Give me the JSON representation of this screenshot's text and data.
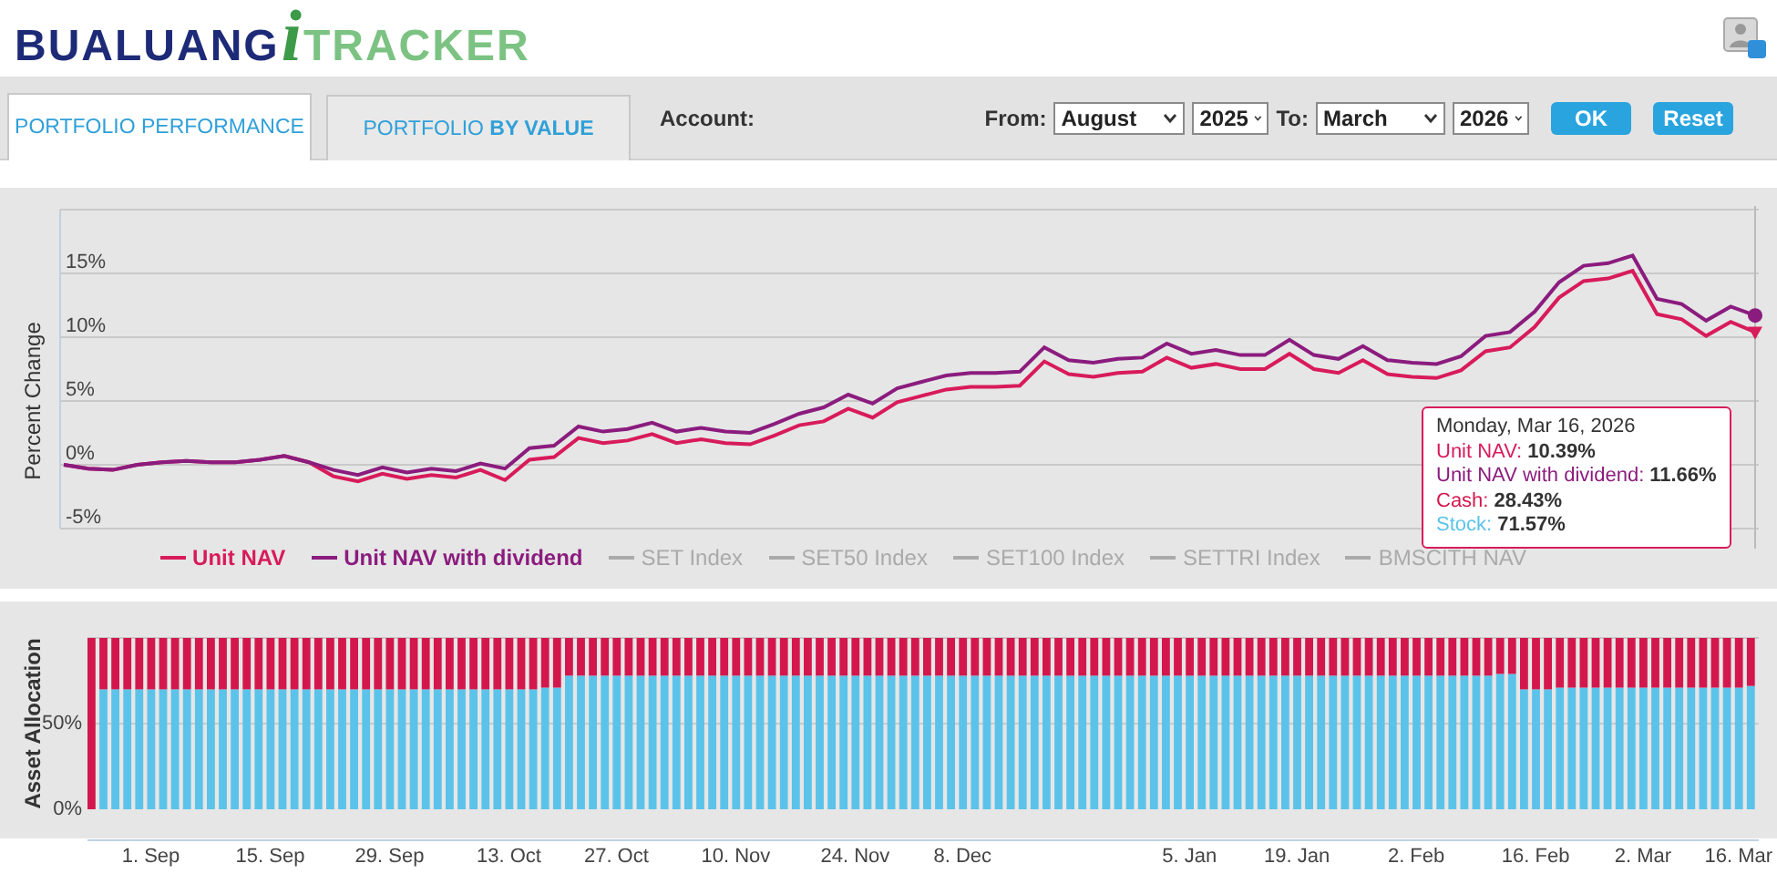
{
  "header": {
    "logo": {
      "brand": "BUALUANG",
      "mark": "i",
      "product": "TRACKER"
    }
  },
  "toolbar": {
    "tabs": [
      {
        "label": "PORTFOLIO PERFORMANCE",
        "selected": true
      },
      {
        "label": "PORTFOLIO **BY VALUE**",
        "selected": false
      }
    ],
    "account_label": "Account:",
    "from_label": "From:",
    "from_month": "August",
    "from_year": "2025",
    "to_label": "To:",
    "to_month": "March",
    "to_year": "2026",
    "buttons": [
      "OK",
      "Reset"
    ]
  },
  "performance": {
    "chart_data": {
      "type": "line",
      "grid": true,
      "ylabel": "Percent Change",
      "ylim": [
        -5,
        20
      ],
      "yticks": [
        {
          "value": -5,
          "label": "-5%"
        },
        {
          "value": 0,
          "label": "0%"
        },
        {
          "value": 5,
          "label": "5%"
        },
        {
          "value": 10,
          "label": "10%"
        },
        {
          "value": 15,
          "label": "15%"
        }
      ],
      "series": [
        {
          "name": "Unit NAV",
          "color": "#d81b5a",
          "values": [
            0,
            -0.3,
            -0.4,
            0,
            0.2,
            0.3,
            0.2,
            0.2,
            0.4,
            0.7,
            0.2,
            -0.9,
            -1.3,
            -0.7,
            -1.1,
            -0.8,
            -1,
            -0.4,
            -1.2,
            0.4,
            0.6,
            2.1,
            1.7,
            1.9,
            2.4,
            1.7,
            2,
            1.7,
            1.6,
            2.3,
            3.1,
            3.4,
            4.4,
            3.7,
            4.9,
            5.4,
            5.9,
            6.1,
            6.1,
            6.2,
            8.1,
            7.1,
            6.9,
            7.2,
            7.3,
            8.4,
            7.6,
            7.9,
            7.5,
            7.5,
            8.7,
            7.5,
            7.2,
            8.2,
            7.1,
            6.9,
            6.8,
            7.4,
            8.9,
            9.2,
            10.8,
            13.1,
            14.4,
            14.6,
            15.2,
            11.8,
            11.4,
            10.1,
            11.2,
            10.4
          ]
        },
        {
          "name": "Unit NAV with dividend",
          "color": "#8b1c7e",
          "values": [
            0,
            -0.3,
            -0.4,
            0,
            0.2,
            0.3,
            0.2,
            0.2,
            0.4,
            0.7,
            0.2,
            -0.4,
            -0.8,
            -0.2,
            -0.6,
            -0.3,
            -0.5,
            0.1,
            -0.3,
            1.3,
            1.5,
            3,
            2.6,
            2.8,
            3.3,
            2.6,
            2.9,
            2.6,
            2.5,
            3.2,
            4,
            4.5,
            5.5,
            4.8,
            6,
            6.5,
            7,
            7.2,
            7.2,
            7.3,
            9.2,
            8.2,
            8,
            8.3,
            8.4,
            9.5,
            8.7,
            9,
            8.6,
            8.6,
            9.8,
            8.6,
            8.3,
            9.3,
            8.2,
            8,
            7.9,
            8.5,
            10.1,
            10.4,
            12,
            14.3,
            15.6,
            15.8,
            16.4,
            13,
            12.6,
            11.3,
            12.4,
            11.7
          ]
        }
      ]
    },
    "legend": [
      {
        "label": "SET Index",
        "visible": false
      },
      {
        "label": "SET50 Index",
        "visible": false
      },
      {
        "label": "SET100 Index",
        "visible": false
      },
      {
        "label": "SETTRI Index",
        "visible": false
      },
      {
        "label": "BMSCITH NAV",
        "visible": false
      }
    ],
    "tooltip": {
      "date": "Monday, Mar 16, 2026",
      "rows": [
        {
          "kind": "nav",
          "label": "Unit NAV",
          "separator": ":",
          "value": "10.39%",
          "color": "#d81b5a"
        },
        {
          "kind": "nav",
          "label": "Unit NAV with dividend",
          "separator": ":",
          "value": "11.66%",
          "color": "#8b1c7e"
        },
        {
          "kind": "allocation",
          "separator": ":",
          "value": "28.43%"
        },
        {
          "kind": "allocation",
          "separator": ":",
          "value": "71.57%"
        }
      ]
    }
  },
  "allocation": {
    "chart_data": {
      "type": "bar",
      "stacked": true,
      "ylabel": "Asset Allocation",
      "ylim": [
        0,
        1
      ],
      "yticks": [
        {
          "value": 0,
          "label": "0%"
        },
        {
          "value": 0.5,
          "label": "50%"
        }
      ],
      "series": [
        {
          "name": "Stock",
          "color": "#5bc3ea",
          "values": [
            0,
            0.7,
            0.7,
            0.7,
            0.7,
            0.7,
            0.7,
            0.7,
            0.7,
            0.7,
            0.7,
            0.7,
            0.7,
            0.7,
            0.7,
            0.7,
            0.7,
            0.7,
            0.7,
            0.7,
            0.7,
            0.7,
            0.7,
            0.7,
            0.7,
            0.7,
            0.7,
            0.7,
            0.7,
            0.7,
            0.7,
            0.7,
            0.7,
            0.7,
            0.7,
            0.7,
            0.7,
            0.7,
            0.71,
            0.71,
            0.78,
            0.78,
            0.78,
            0.78,
            0.78,
            0.78,
            0.78,
            0.78,
            0.78,
            0.78,
            0.78,
            0.78,
            0.78,
            0.78,
            0.78,
            0.78,
            0.78,
            0.78,
            0.78,
            0.78,
            0.78,
            0.78,
            0.78,
            0.78,
            0.78,
            0.78,
            0.78,
            0.78,
            0.78,
            0.78,
            0.78,
            0.78,
            0.78,
            0.78,
            0.78,
            0.78,
            0.78,
            0.78,
            0.78,
            0.78,
            0.78,
            0.78,
            0.78,
            0.78,
            0.78,
            0.78,
            0.78,
            0.78,
            0.78,
            0.78,
            0.78,
            0.78,
            0.78,
            0.78,
            0.78,
            0.78,
            0.78,
            0.78,
            0.78,
            0.78,
            0.78,
            0.78,
            0.78,
            0.78,
            0.78,
            0.78,
            0.78,
            0.78,
            0.78,
            0.78,
            0.78,
            0.78,
            0.78,
            0.78,
            0.78,
            0.78,
            0.78,
            0.78,
            0.79,
            0.79,
            0.7,
            0.7,
            0.7,
            0.71,
            0.71,
            0.71,
            0.71,
            0.71,
            0.71,
            0.71,
            0.71,
            0.71,
            0.71,
            0.71,
            0.71,
            0.71,
            0.71,
            0.71,
            0.71,
            0.72
          ]
        },
        {
          "name": "Cash",
          "color": "#d3174d",
          "values": [
            1,
            0.3,
            0.3,
            0.3,
            0.3,
            0.3,
            0.3,
            0.3,
            0.3,
            0.3,
            0.3,
            0.3,
            0.3,
            0.3,
            0.3,
            0.3,
            0.3,
            0.3,
            0.3,
            0.3,
            0.3,
            0.3,
            0.3,
            0.3,
            0.3,
            0.3,
            0.3,
            0.3,
            0.3,
            0.3,
            0.3,
            0.3,
            0.3,
            0.3,
            0.3,
            0.3,
            0.3,
            0.3,
            0.29,
            0.29,
            0.22,
            0.22,
            0.22,
            0.22,
            0.22,
            0.22,
            0.22,
            0.22,
            0.22,
            0.22,
            0.22,
            0.22,
            0.22,
            0.22,
            0.22,
            0.22,
            0.22,
            0.22,
            0.22,
            0.22,
            0.22,
            0.22,
            0.22,
            0.22,
            0.22,
            0.22,
            0.22,
            0.22,
            0.22,
            0.22,
            0.22,
            0.22,
            0.22,
            0.22,
            0.22,
            0.22,
            0.22,
            0.22,
            0.22,
            0.22,
            0.22,
            0.22,
            0.22,
            0.22,
            0.22,
            0.22,
            0.22,
            0.22,
            0.22,
            0.22,
            0.22,
            0.22,
            0.22,
            0.22,
            0.22,
            0.22,
            0.22,
            0.22,
            0.22,
            0.22,
            0.22,
            0.22,
            0.22,
            0.22,
            0.22,
            0.22,
            0.22,
            0.22,
            0.22,
            0.22,
            0.22,
            0.22,
            0.22,
            0.22,
            0.22,
            0.22,
            0.22,
            0.22,
            0.21,
            0.21,
            0.3,
            0.3,
            0.3,
            0.29,
            0.29,
            0.29,
            0.29,
            0.29,
            0.29,
            0.29,
            0.29,
            0.29,
            0.29,
            0.29,
            0.29,
            0.29,
            0.29,
            0.29,
            0.29,
            0.28
          ]
        }
      ]
    },
    "date_axis": [
      "1. Sep",
      "15. Sep",
      "29. Sep",
      "13. Oct",
      "27. Oct",
      "10. Nov",
      "24. Nov",
      "8. Dec",
      "5. Jan",
      "19. Jan",
      "2. Feb",
      "16. Feb",
      "2. Mar",
      "16. Mar"
    ]
  }
}
